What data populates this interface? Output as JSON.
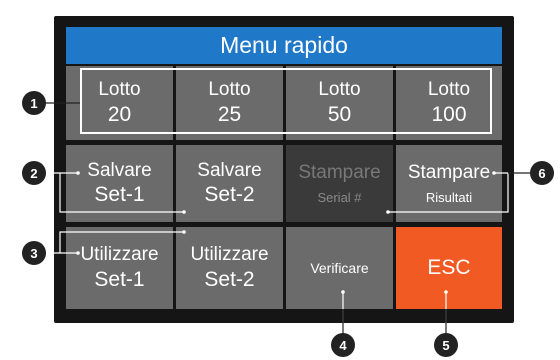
{
  "header": {
    "title": "Menu rapido"
  },
  "lots": [
    {
      "label": "Lotto",
      "value": "20"
    },
    {
      "label": "Lotto",
      "value": "25"
    },
    {
      "label": "Lotto",
      "value": "50"
    },
    {
      "label": "Lotto",
      "value": "100"
    }
  ],
  "save": [
    {
      "label": "Salvare",
      "value": "Set-1"
    },
    {
      "label": "Salvare",
      "value": "Set-2"
    }
  ],
  "print_serial": {
    "label": "Stampare",
    "value": "Serial #"
  },
  "print_results": {
    "label": "Stampare",
    "value": "Risultati"
  },
  "use": [
    {
      "label": "Utilizzare",
      "value": "Set-1"
    },
    {
      "label": "Utilizzare",
      "value": "Set-2"
    }
  ],
  "verify": {
    "label": "Verificare"
  },
  "esc": {
    "label": "ESC"
  },
  "callouts": [
    "1",
    "2",
    "3",
    "4",
    "5",
    "6"
  ],
  "colors": {
    "header": "#1f78c8",
    "tile": "#6b6b6b",
    "disabled": "#3a3a3a",
    "esc": "#f15a22",
    "background": "#151515"
  }
}
